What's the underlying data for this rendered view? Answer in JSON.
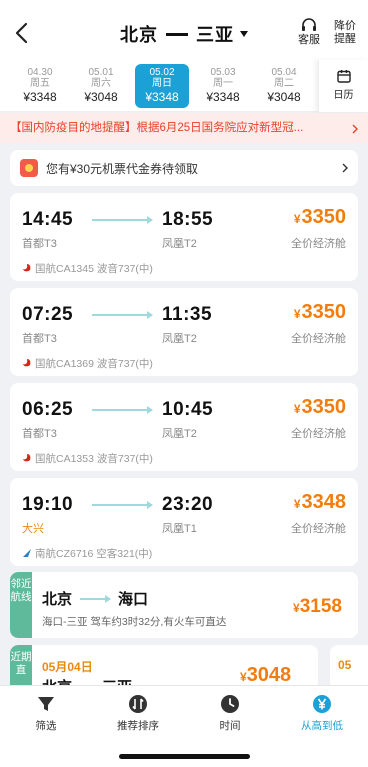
{
  "header": {
    "origin": "北京",
    "destination": "三亚",
    "service_label": "客服",
    "price_alert_line1": "降价",
    "price_alert_line2": "提醒"
  },
  "dates": [
    {
      "date": "04.30",
      "weekday": "周五",
      "price": "¥3348",
      "active": false
    },
    {
      "date": "05.01",
      "weekday": "周六",
      "price": "¥3048",
      "active": false
    },
    {
      "date": "05.02",
      "weekday": "周日",
      "price": "¥3348",
      "active": true
    },
    {
      "date": "05.03",
      "weekday": "周一",
      "price": "¥3348",
      "active": false
    },
    {
      "date": "05.04",
      "weekday": "周二",
      "price": "¥3048",
      "active": false
    }
  ],
  "calendar_label": "日历",
  "notice": "【国内防疫目的地提醒】根据6月25日国务院应对新型冠...",
  "coupon": {
    "text": "您有¥30元机票代金券待领取"
  },
  "flights": [
    {
      "dep_time": "14:45",
      "dep_airport": "首都T3",
      "arr_time": "18:55",
      "arr_airport": "凤凰T2",
      "price": "3350",
      "cabin": "全价经济舱",
      "airline": "国航CA1345  波音737(中)"
    },
    {
      "dep_time": "07:25",
      "dep_airport": "首都T3",
      "arr_time": "11:35",
      "arr_airport": "凤凰T2",
      "price": "3350",
      "cabin": "全价经济舱",
      "airline": "国航CA1369  波音737(中)"
    },
    {
      "dep_time": "06:25",
      "dep_airport": "首都T3",
      "arr_time": "10:45",
      "arr_airport": "凤凰T2",
      "price": "3350",
      "cabin": "全价经济舱",
      "airline": "国航CA1353  波音737(中)"
    },
    {
      "dep_time": "19:10",
      "dep_airport": "大兴",
      "arr_time": "23:20",
      "arr_airport": "凤凰T1",
      "price": "3348",
      "cabin": "全价经济舱",
      "airline": "南航CZ6716  空客321(中)"
    }
  ],
  "nearby": {
    "tag": "邻近航线",
    "from": "北京",
    "to": "海口",
    "desc": "海口-三亚 驾车约3时32分,有火车可直达",
    "price": "3158"
  },
  "recent": {
    "tag": "近期直",
    "date": "05月04日",
    "cities_from": "北京",
    "cities_to": "三亚",
    "price": "3048",
    "next_date": "05"
  },
  "bottom_bar": [
    {
      "label": "筛选",
      "icon": "filter-icon",
      "active": false
    },
    {
      "label": "推荐排序",
      "icon": "sort-icon",
      "active": false
    },
    {
      "label": "时间",
      "icon": "clock-icon",
      "active": false
    },
    {
      "label": "从高到低",
      "icon": "yen-icon",
      "active": true
    }
  ],
  "colors": {
    "accent": "#1ba1d6",
    "price": "#f37d0c",
    "notice": "#e8402c",
    "tag": "#5fb99b"
  }
}
